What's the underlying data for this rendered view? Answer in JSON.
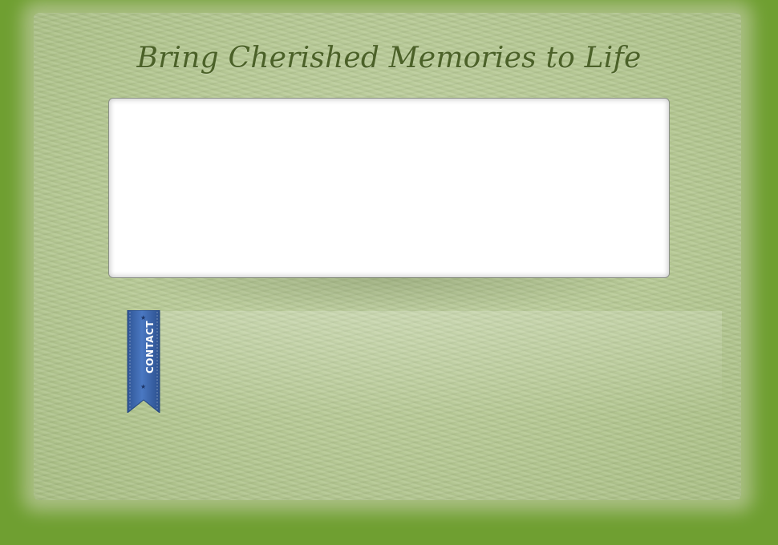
{
  "page": {
    "headline": "Bring Cherished Memories to Life"
  },
  "slideshow": {
    "caption": ""
  },
  "ribbon": {
    "label": "CONTACT",
    "star_glyph": "★",
    "icon": "star-icon",
    "color": "#3f69b0"
  },
  "colors": {
    "frame_green": "#6f9f31",
    "paper": "#b6c994",
    "headline": "#4b6128"
  }
}
